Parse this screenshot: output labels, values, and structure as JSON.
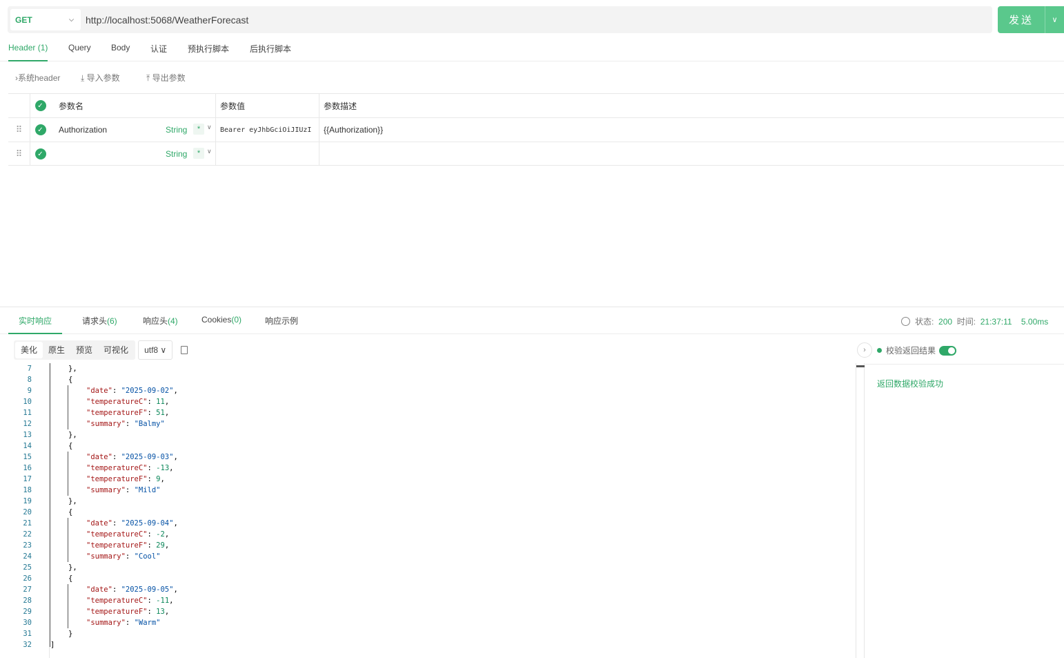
{
  "request": {
    "method": "GET",
    "url": "http://localhost:5068/WeatherForecast",
    "send_label": "发送"
  },
  "req_tabs": [
    "Header (1)",
    "Query",
    "Body",
    "认证",
    "预执行脚本",
    "后执行脚本"
  ],
  "toolbar": {
    "system_header": "系统header",
    "import": "导入参数",
    "export": "导出参数"
  },
  "param_table": {
    "headers": {
      "name": "参数名",
      "value": "参数值",
      "desc": "参数描述"
    },
    "rows": [
      {
        "name": "Authorization",
        "type": "String",
        "required": "*",
        "value": "Bearer eyJhbGciOiJIUzI",
        "desc": "{{Authorization}}"
      },
      {
        "name": "",
        "type": "String",
        "required": "*",
        "value": "",
        "desc": ""
      }
    ]
  },
  "resp_tabs": {
    "live": "实时响应",
    "req_headers": "请求头",
    "req_headers_count": "(6)",
    "resp_headers": "响应头",
    "resp_headers_count": "(4)",
    "cookies": "Cookies",
    "cookies_count": "(0)",
    "example": "响应示例"
  },
  "status": {
    "status_label": "状态:",
    "status_code": "200",
    "time_label": "时间:",
    "time": "21:37:11",
    "duration": "5.00ms"
  },
  "format": {
    "options": [
      "美化",
      "原生",
      "预览",
      "可视化"
    ],
    "encoding": "utf8"
  },
  "code_lines": [
    {
      "n": "7",
      "indent": 1,
      "parts": [
        {
          "t": "},",
          "c": "p"
        }
      ]
    },
    {
      "n": "8",
      "indent": 1,
      "parts": [
        {
          "t": "{",
          "c": "p"
        }
      ]
    },
    {
      "n": "9",
      "indent": 2,
      "parts": [
        {
          "t": "\"date\"",
          "c": "k"
        },
        {
          "t": ": ",
          "c": "p"
        },
        {
          "t": "\"2025-09-02\"",
          "c": "s"
        },
        {
          "t": ",",
          "c": "p"
        }
      ]
    },
    {
      "n": "10",
      "indent": 2,
      "parts": [
        {
          "t": "\"temperatureC\"",
          "c": "k"
        },
        {
          "t": ": ",
          "c": "p"
        },
        {
          "t": "11",
          "c": "n"
        },
        {
          "t": ",",
          "c": "p"
        }
      ]
    },
    {
      "n": "11",
      "indent": 2,
      "parts": [
        {
          "t": "\"temperatureF\"",
          "c": "k"
        },
        {
          "t": ": ",
          "c": "p"
        },
        {
          "t": "51",
          "c": "n"
        },
        {
          "t": ",",
          "c": "p"
        }
      ]
    },
    {
      "n": "12",
      "indent": 2,
      "parts": [
        {
          "t": "\"summary\"",
          "c": "k"
        },
        {
          "t": ": ",
          "c": "p"
        },
        {
          "t": "\"Balmy\"",
          "c": "s"
        }
      ]
    },
    {
      "n": "13",
      "indent": 1,
      "parts": [
        {
          "t": "},",
          "c": "p"
        }
      ]
    },
    {
      "n": "14",
      "indent": 1,
      "parts": [
        {
          "t": "{",
          "c": "p"
        }
      ]
    },
    {
      "n": "15",
      "indent": 2,
      "parts": [
        {
          "t": "\"date\"",
          "c": "k"
        },
        {
          "t": ": ",
          "c": "p"
        },
        {
          "t": "\"2025-09-03\"",
          "c": "s"
        },
        {
          "t": ",",
          "c": "p"
        }
      ]
    },
    {
      "n": "16",
      "indent": 2,
      "parts": [
        {
          "t": "\"temperatureC\"",
          "c": "k"
        },
        {
          "t": ": ",
          "c": "p"
        },
        {
          "t": "-13",
          "c": "n"
        },
        {
          "t": ",",
          "c": "p"
        }
      ]
    },
    {
      "n": "17",
      "indent": 2,
      "parts": [
        {
          "t": "\"temperatureF\"",
          "c": "k"
        },
        {
          "t": ": ",
          "c": "p"
        },
        {
          "t": "9",
          "c": "n"
        },
        {
          "t": ",",
          "c": "p"
        }
      ]
    },
    {
      "n": "18",
      "indent": 2,
      "parts": [
        {
          "t": "\"summary\"",
          "c": "k"
        },
        {
          "t": ": ",
          "c": "p"
        },
        {
          "t": "\"Mild\"",
          "c": "s"
        }
      ]
    },
    {
      "n": "19",
      "indent": 1,
      "parts": [
        {
          "t": "},",
          "c": "p"
        }
      ]
    },
    {
      "n": "20",
      "indent": 1,
      "parts": [
        {
          "t": "{",
          "c": "p"
        }
      ]
    },
    {
      "n": "21",
      "indent": 2,
      "parts": [
        {
          "t": "\"date\"",
          "c": "k"
        },
        {
          "t": ": ",
          "c": "p"
        },
        {
          "t": "\"2025-09-04\"",
          "c": "s"
        },
        {
          "t": ",",
          "c": "p"
        }
      ]
    },
    {
      "n": "22",
      "indent": 2,
      "parts": [
        {
          "t": "\"temperatureC\"",
          "c": "k"
        },
        {
          "t": ": ",
          "c": "p"
        },
        {
          "t": "-2",
          "c": "n"
        },
        {
          "t": ",",
          "c": "p"
        }
      ]
    },
    {
      "n": "23",
      "indent": 2,
      "parts": [
        {
          "t": "\"temperatureF\"",
          "c": "k"
        },
        {
          "t": ": ",
          "c": "p"
        },
        {
          "t": "29",
          "c": "n"
        },
        {
          "t": ",",
          "c": "p"
        }
      ]
    },
    {
      "n": "24",
      "indent": 2,
      "parts": [
        {
          "t": "\"summary\"",
          "c": "k"
        },
        {
          "t": ": ",
          "c": "p"
        },
        {
          "t": "\"Cool\"",
          "c": "s"
        }
      ]
    },
    {
      "n": "25",
      "indent": 1,
      "parts": [
        {
          "t": "},",
          "c": "p"
        }
      ]
    },
    {
      "n": "26",
      "indent": 1,
      "parts": [
        {
          "t": "{",
          "c": "p"
        }
      ]
    },
    {
      "n": "27",
      "indent": 2,
      "parts": [
        {
          "t": "\"date\"",
          "c": "k"
        },
        {
          "t": ": ",
          "c": "p"
        },
        {
          "t": "\"2025-09-05\"",
          "c": "s"
        },
        {
          "t": ",",
          "c": "p"
        }
      ]
    },
    {
      "n": "28",
      "indent": 2,
      "parts": [
        {
          "t": "\"temperatureC\"",
          "c": "k"
        },
        {
          "t": ": ",
          "c": "p"
        },
        {
          "t": "-11",
          "c": "n"
        },
        {
          "t": ",",
          "c": "p"
        }
      ]
    },
    {
      "n": "29",
      "indent": 2,
      "parts": [
        {
          "t": "\"temperatureF\"",
          "c": "k"
        },
        {
          "t": ": ",
          "c": "p"
        },
        {
          "t": "13",
          "c": "n"
        },
        {
          "t": ",",
          "c": "p"
        }
      ]
    },
    {
      "n": "30",
      "indent": 2,
      "parts": [
        {
          "t": "\"summary\"",
          "c": "k"
        },
        {
          "t": ": ",
          "c": "p"
        },
        {
          "t": "\"Warm\"",
          "c": "s"
        }
      ]
    },
    {
      "n": "31",
      "indent": 1,
      "parts": [
        {
          "t": "}",
          "c": "p"
        }
      ]
    },
    {
      "n": "32",
      "indent": 0,
      "parts": [
        {
          "t": "]",
          "c": "p"
        }
      ]
    }
  ],
  "validation": {
    "label": "校验返回结果",
    "enabled": true,
    "message": "返回数据校验成功"
  },
  "colors": {
    "accent": "#2fa868",
    "send_button": "#5ac88c"
  }
}
